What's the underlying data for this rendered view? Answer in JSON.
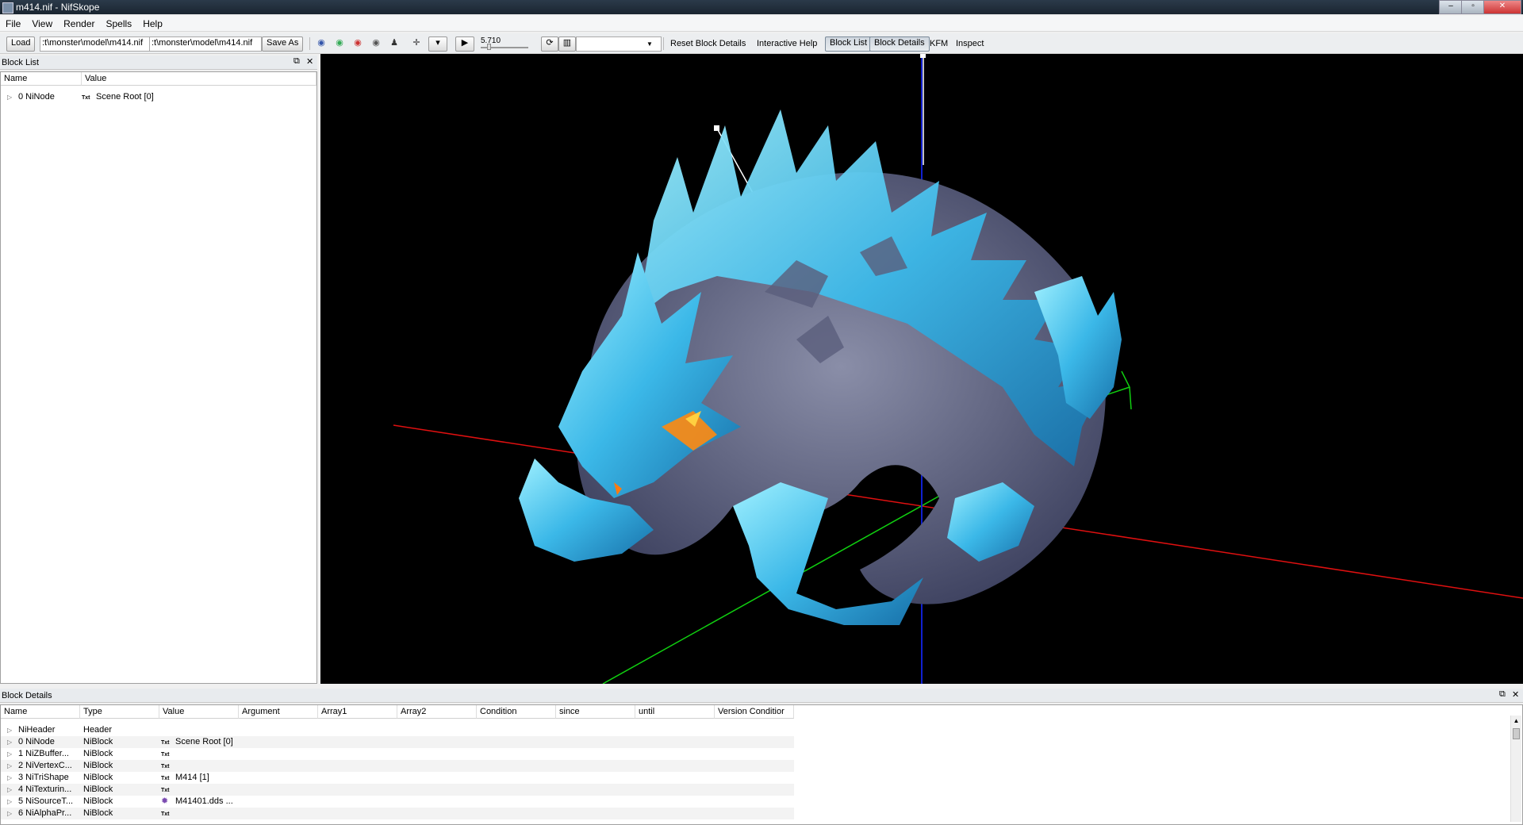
{
  "window": {
    "title": "m414.nif - NifSkope",
    "min": "–",
    "max": "▫",
    "close": "✕"
  },
  "menu": [
    "File",
    "View",
    "Render",
    "Spells",
    "Help"
  ],
  "toolbar": {
    "load_label": "Load",
    "load_path": ":t\\monster\\model\\m414.nif",
    "save_path": ":t\\monster\\model\\m414.nif",
    "save_label": "Save As",
    "time_value": "5.710",
    "reset_label": "Reset Block Details",
    "help_label": "Interactive Help",
    "blocklist_label": "Block List",
    "blockdetails_label": "Block Details",
    "kfm_label": "KFM",
    "inspect_label": "Inspect"
  },
  "block_list": {
    "title": "Block List",
    "columns": [
      "Name",
      "Value"
    ],
    "rows": [
      {
        "name": "0 NiNode",
        "tag": "Txt",
        "value": "Scene Root [0]"
      }
    ]
  },
  "block_details": {
    "title": "Block Details",
    "columns": [
      "Name",
      "Type",
      "Value",
      "Argument",
      "Array1",
      "Array2",
      "Condition",
      "since",
      "until",
      "Version Conditior"
    ],
    "rows": [
      {
        "name": "NiHeader",
        "type": "Header",
        "tag": "",
        "value": ""
      },
      {
        "name": "0 NiNode",
        "type": "NiBlock",
        "tag": "Txt",
        "value": "Scene Root [0]"
      },
      {
        "name": "1 NiZBuffer...",
        "type": "NiBlock",
        "tag": "Txt",
        "value": ""
      },
      {
        "name": "2 NiVertexC...",
        "type": "NiBlock",
        "tag": "Txt",
        "value": ""
      },
      {
        "name": "3 NiTriShape",
        "type": "NiBlock",
        "tag": "Txt",
        "value": "M414 [1]"
      },
      {
        "name": "4 NiTexturin...",
        "type": "NiBlock",
        "tag": "Txt",
        "value": ""
      },
      {
        "name": "5 NiSourceT...",
        "type": "NiBlock",
        "tag": "✹",
        "value": "M41401.dds ..."
      },
      {
        "name": "6 NiAlphaPr...",
        "type": "NiBlock",
        "tag": "Txt",
        "value": ""
      }
    ]
  },
  "colors": {
    "x_axis": "#e01010",
    "y_axis": "#10d010",
    "z_axis": "#1020d0",
    "ice_light": "#5fd0f0",
    "ice_dark": "#1a7fb8",
    "rock": "#6a6e88"
  }
}
